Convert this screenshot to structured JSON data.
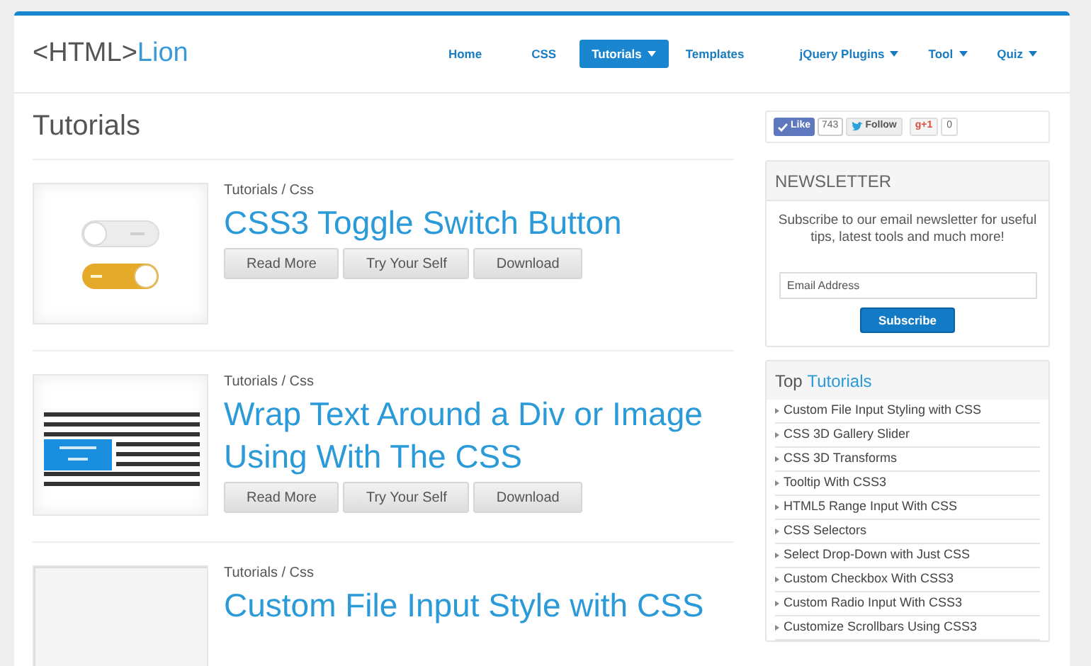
{
  "logo": {
    "prefix": "<HTML>",
    "name": "Lion"
  },
  "nav": [
    {
      "label": "Home",
      "selected": false,
      "dropdown": false
    },
    {
      "label": "CSS",
      "selected": false,
      "dropdown": false
    },
    {
      "label": "Tutorials",
      "selected": true,
      "dropdown": true
    },
    {
      "label": "Templates",
      "selected": false,
      "dropdown": false
    },
    {
      "label": "jQuery Plugins",
      "selected": false,
      "dropdown": true
    },
    {
      "label": "Tool",
      "selected": false,
      "dropdown": true
    },
    {
      "label": "Quiz",
      "selected": false,
      "dropdown": true
    }
  ],
  "page_title": "Tutorials",
  "articles": [
    {
      "category": "Tutorials / Css",
      "title": "CSS3 Toggle Switch Button",
      "buttons": [
        "Read More",
        "Try Your Self",
        "Download"
      ]
    },
    {
      "category": "Tutorials / Css",
      "title": "Wrap Text Around a Div or Image Using With The CSS",
      "buttons": [
        "Read More",
        "Try Your Self",
        "Download"
      ]
    },
    {
      "category": "Tutorials / Css",
      "title": "Custom File Input Style with CSS"
    }
  ],
  "social": {
    "like": "Like",
    "like_count": "743",
    "follow": "Follow",
    "plus": "g+1",
    "plus_count": "0"
  },
  "newsletter": {
    "title": "NEWSLETTER",
    "text": "Subscribe to our email newsletter for useful tips, latest tools and much more!",
    "email_placeholder": "Email Address",
    "button": "Subscribe"
  },
  "top": {
    "title_prefix": "Top",
    "title_highlight": "Tutorials",
    "items": [
      "Custom File Input Styling with CSS",
      "CSS 3D Gallery Slider",
      "CSS 3D Transforms",
      "Tooltip With CSS3",
      "HTML5 Range Input With CSS",
      "CSS Selectors",
      "Select Drop-Down with Just CSS",
      "Custom Checkbox With CSS3",
      "Custom Radio Input With CSS3",
      "Customize Scrollbars Using CSS3"
    ]
  }
}
